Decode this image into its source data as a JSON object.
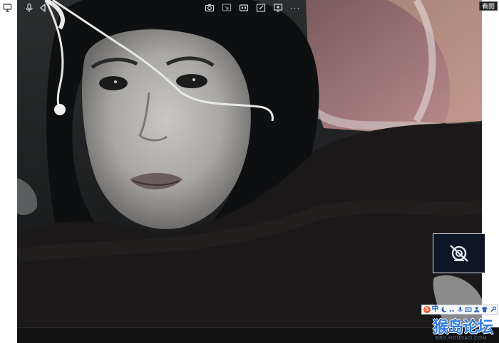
{
  "window": {
    "corner_badge": "看图"
  },
  "video": {
    "camera_overlay_icon": "camera-off-icon"
  },
  "toolbar": {
    "icons": [
      {
        "name": "window-icon"
      },
      {
        "name": "microphone-icon"
      },
      {
        "name": "speaker-icon"
      },
      {
        "name": "snapshot-icon"
      },
      {
        "name": "screen-share-icon"
      },
      {
        "name": "video-mode-icon"
      },
      {
        "name": "whiteboard-icon"
      },
      {
        "name": "record-icon"
      }
    ],
    "more_label": "···"
  },
  "ime_tray": {
    "logo": "S",
    "mode": "中",
    "icons": [
      "moon-icon",
      "punctuation-icon",
      "microphone-icon",
      "keyboard-icon",
      "user-icon",
      "shirt-icon",
      "wrench-icon"
    ]
  },
  "watermark": {
    "title": "猴岛论坛",
    "url": "BBS.HOUDAO.COM"
  },
  "colors": {
    "toolbar_bg": "#111111",
    "overlay_bg": "#0c1624",
    "watermark_blue": "#2e7de0",
    "ime_orange": "#f1582a"
  }
}
